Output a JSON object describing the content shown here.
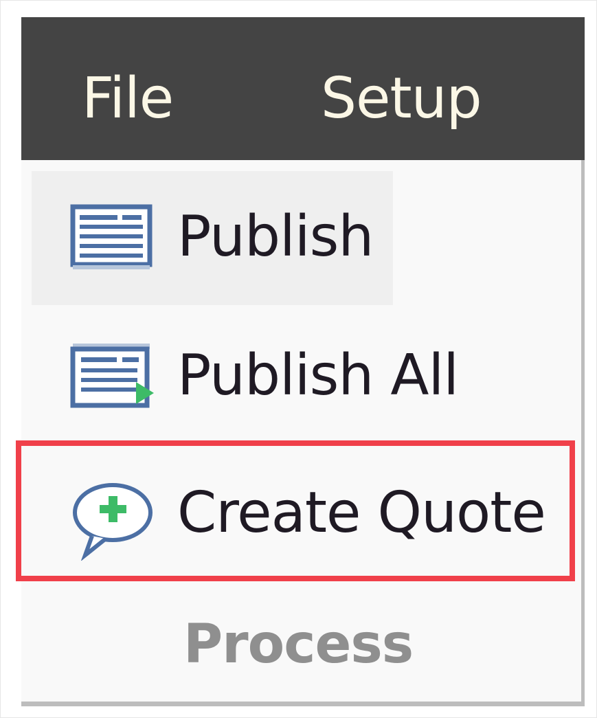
{
  "menubar": {
    "items": [
      {
        "label": "File"
      },
      {
        "label": "Setup"
      }
    ]
  },
  "dropdown": {
    "items": [
      {
        "label": "Publish",
        "icon": "publish-icon",
        "state": "hovered"
      },
      {
        "label": "Publish All",
        "icon": "publish-all-icon"
      },
      {
        "label": "Create Quote",
        "icon": "create-quote-icon",
        "highlighted": true
      }
    ],
    "section_label": "Process"
  },
  "colors": {
    "menubar_bg": "#444444",
    "dropdown_bg": "#f9f9f9",
    "hover_bg": "#efefef",
    "highlight_border": "#f0404a",
    "icon_blue": "#4c6fa4",
    "icon_green": "#3dbb67"
  }
}
